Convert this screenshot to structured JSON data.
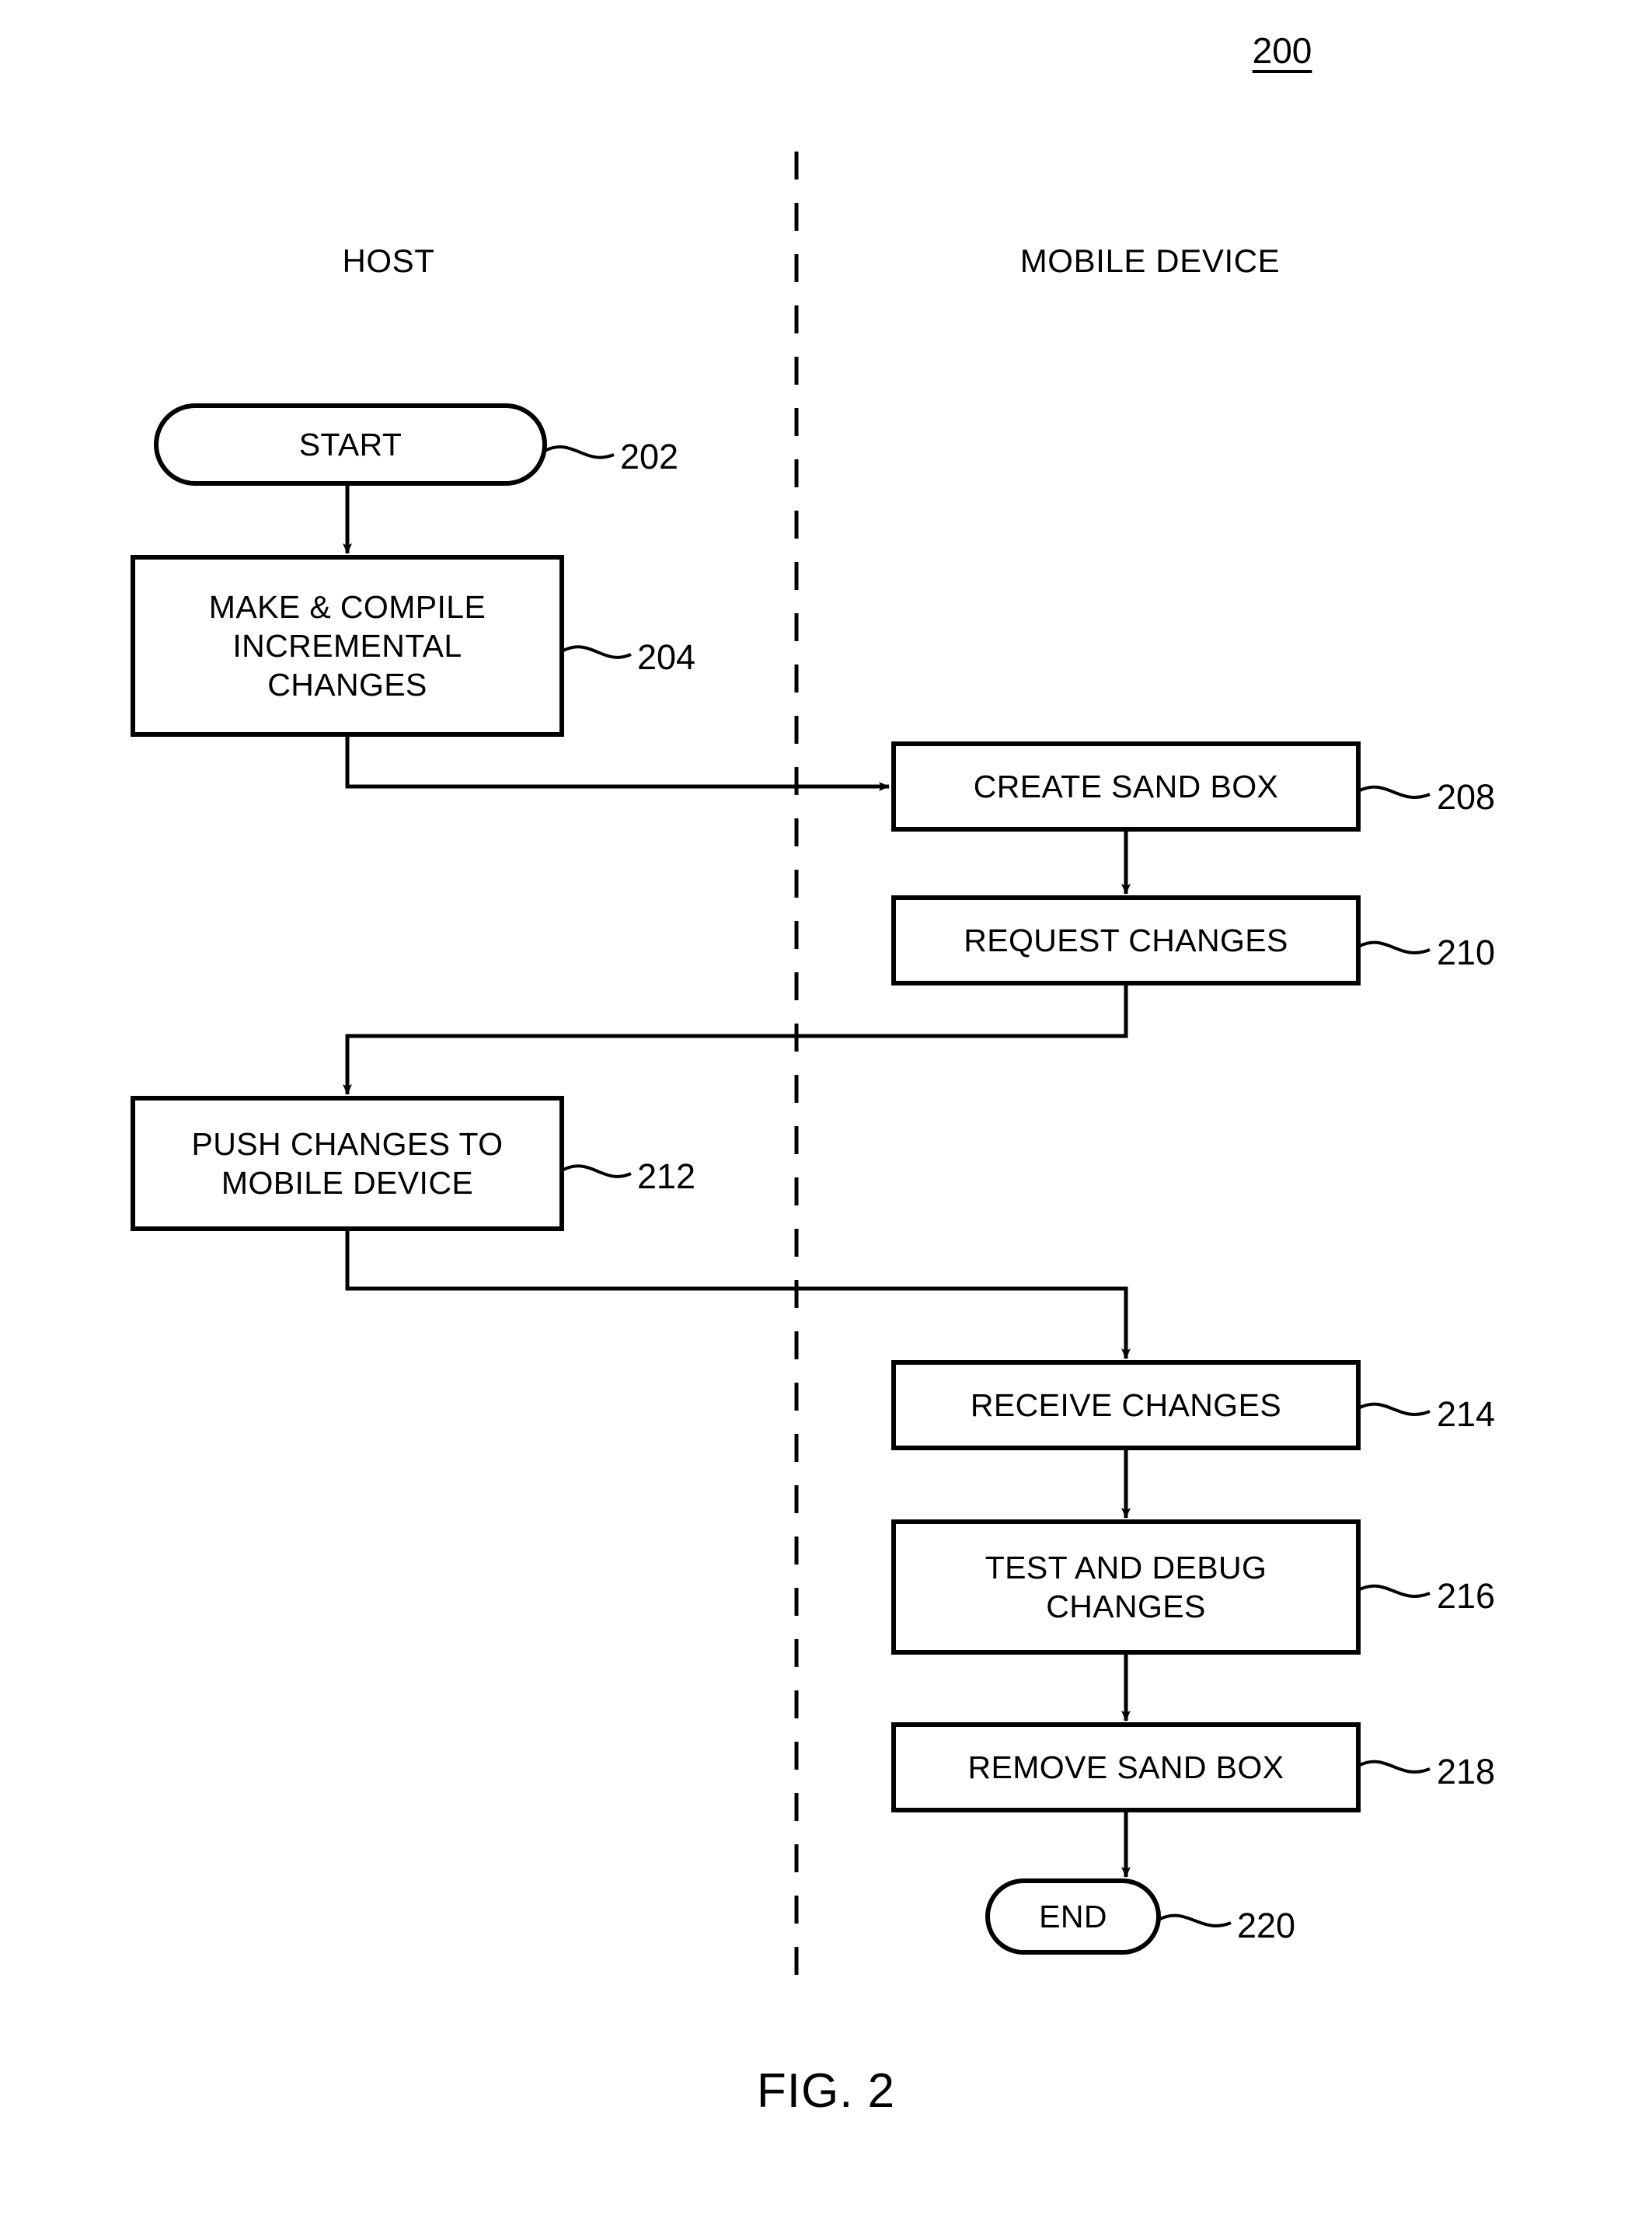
{
  "figure": {
    "number": "200",
    "caption": "FIG. 2"
  },
  "lanes": [
    {
      "id": "host",
      "title": "HOST"
    },
    {
      "id": "mobile",
      "title": "MOBILE DEVICE"
    }
  ],
  "nodes": [
    {
      "id": "start",
      "lane": "host",
      "shape": "stadium",
      "label": "START",
      "ref": "202"
    },
    {
      "id": "make",
      "lane": "host",
      "shape": "rectangle",
      "label": "MAKE & COMPILE\nINCREMENTAL\nCHANGES",
      "ref": "204"
    },
    {
      "id": "sandbox",
      "lane": "mobile",
      "shape": "rectangle",
      "label": "CREATE SAND BOX",
      "ref": "208"
    },
    {
      "id": "request",
      "lane": "mobile",
      "shape": "rectangle",
      "label": "REQUEST CHANGES",
      "ref": "210"
    },
    {
      "id": "push",
      "lane": "host",
      "shape": "rectangle",
      "label": "PUSH CHANGES TO\nMOBILE DEVICE",
      "ref": "212"
    },
    {
      "id": "receive",
      "lane": "mobile",
      "shape": "rectangle",
      "label": "RECEIVE CHANGES",
      "ref": "214"
    },
    {
      "id": "testdbg",
      "lane": "mobile",
      "shape": "rectangle",
      "label": "TEST AND DEBUG\nCHANGES",
      "ref": "216"
    },
    {
      "id": "remove",
      "lane": "mobile",
      "shape": "rectangle",
      "label": "REMOVE SAND BOX",
      "ref": "218"
    },
    {
      "id": "end",
      "lane": "mobile",
      "shape": "stadium",
      "label": "END",
      "ref": "220"
    }
  ],
  "edges": [
    {
      "from": "start",
      "to": "make",
      "routing": "straight-down"
    },
    {
      "from": "make",
      "to": "sandbox",
      "routing": "down-right-into-left-edge"
    },
    {
      "from": "sandbox",
      "to": "request",
      "routing": "straight-down"
    },
    {
      "from": "request",
      "to": "push",
      "routing": "down-left-down"
    },
    {
      "from": "push",
      "to": "receive",
      "routing": "down-right-down"
    },
    {
      "from": "receive",
      "to": "testdbg",
      "routing": "straight-down"
    },
    {
      "from": "testdbg",
      "to": "remove",
      "routing": "straight-down"
    },
    {
      "from": "remove",
      "to": "end",
      "routing": "straight-down"
    }
  ],
  "divider": {
    "style": "dashed",
    "orientation": "vertical"
  },
  "colors": {
    "ink": "#000000",
    "background": "#ffffff"
  }
}
